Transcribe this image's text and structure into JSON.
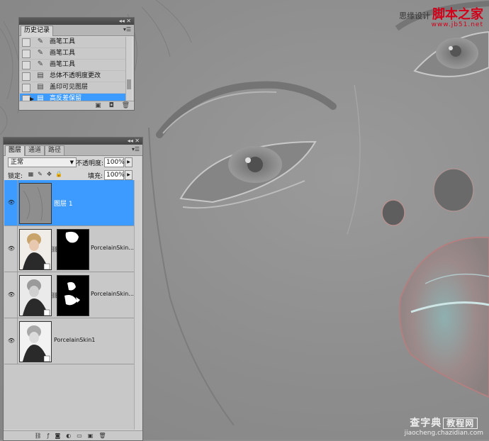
{
  "watermark_top": {
    "prefix": "思缘设计",
    "brand": "脚本之家",
    "url": "www.jb51.net"
  },
  "watermark_bottom": {
    "line1": "查字典",
    "line1_box": "教程网",
    "line2": "jiaocheng.chazidian.com"
  },
  "history_panel": {
    "collapse_label": "◂◂ ✕",
    "tab": "历史记录",
    "menu_icon": "panel-menu-icon",
    "items": [
      {
        "label": "画笔工具",
        "icon": "brush-icon"
      },
      {
        "label": "画笔工具",
        "icon": "brush-icon"
      },
      {
        "label": "画笔工具",
        "icon": "brush-icon"
      },
      {
        "label": "总体不透明度更改",
        "icon": "history-step-icon"
      },
      {
        "label": "盖印可见图层",
        "icon": "history-step-icon"
      },
      {
        "label": "高反差保留",
        "icon": "history-step-icon",
        "selected": true
      }
    ],
    "footer_icons": [
      "new-document-icon",
      "snapshot-icon",
      "trash-icon"
    ]
  },
  "layers_panel": {
    "collapse_label": "◂◂ ✕",
    "tabs": [
      "图层",
      "通道",
      "路径"
    ],
    "active_tab": "图层",
    "blend_mode": "正常",
    "opacity_label": "不透明度:",
    "opacity_value": "100%",
    "lock_label": "锁定:",
    "fill_label": "填充:",
    "fill_value": "100%",
    "layers": [
      {
        "name": "图层 1",
        "selected": true,
        "visible": true,
        "has_mask": false
      },
      {
        "name": "PorcelainSkin...",
        "selected": false,
        "visible": true,
        "has_mask": true
      },
      {
        "name": "PorcelainSkin...",
        "selected": false,
        "visible": true,
        "has_mask": true
      },
      {
        "name": "PorcelainSkin1",
        "selected": false,
        "visible": true,
        "has_mask": false
      }
    ],
    "footer_icons": [
      "link-icon",
      "fx-icon",
      "mask-icon",
      "adjustment-icon",
      "group-icon",
      "new-layer-icon",
      "trash-icon"
    ]
  },
  "colors": {
    "selection": "#3d9aff",
    "panel_bg": "#d6d6d6",
    "canvas_gray": "#8f8f8f"
  }
}
